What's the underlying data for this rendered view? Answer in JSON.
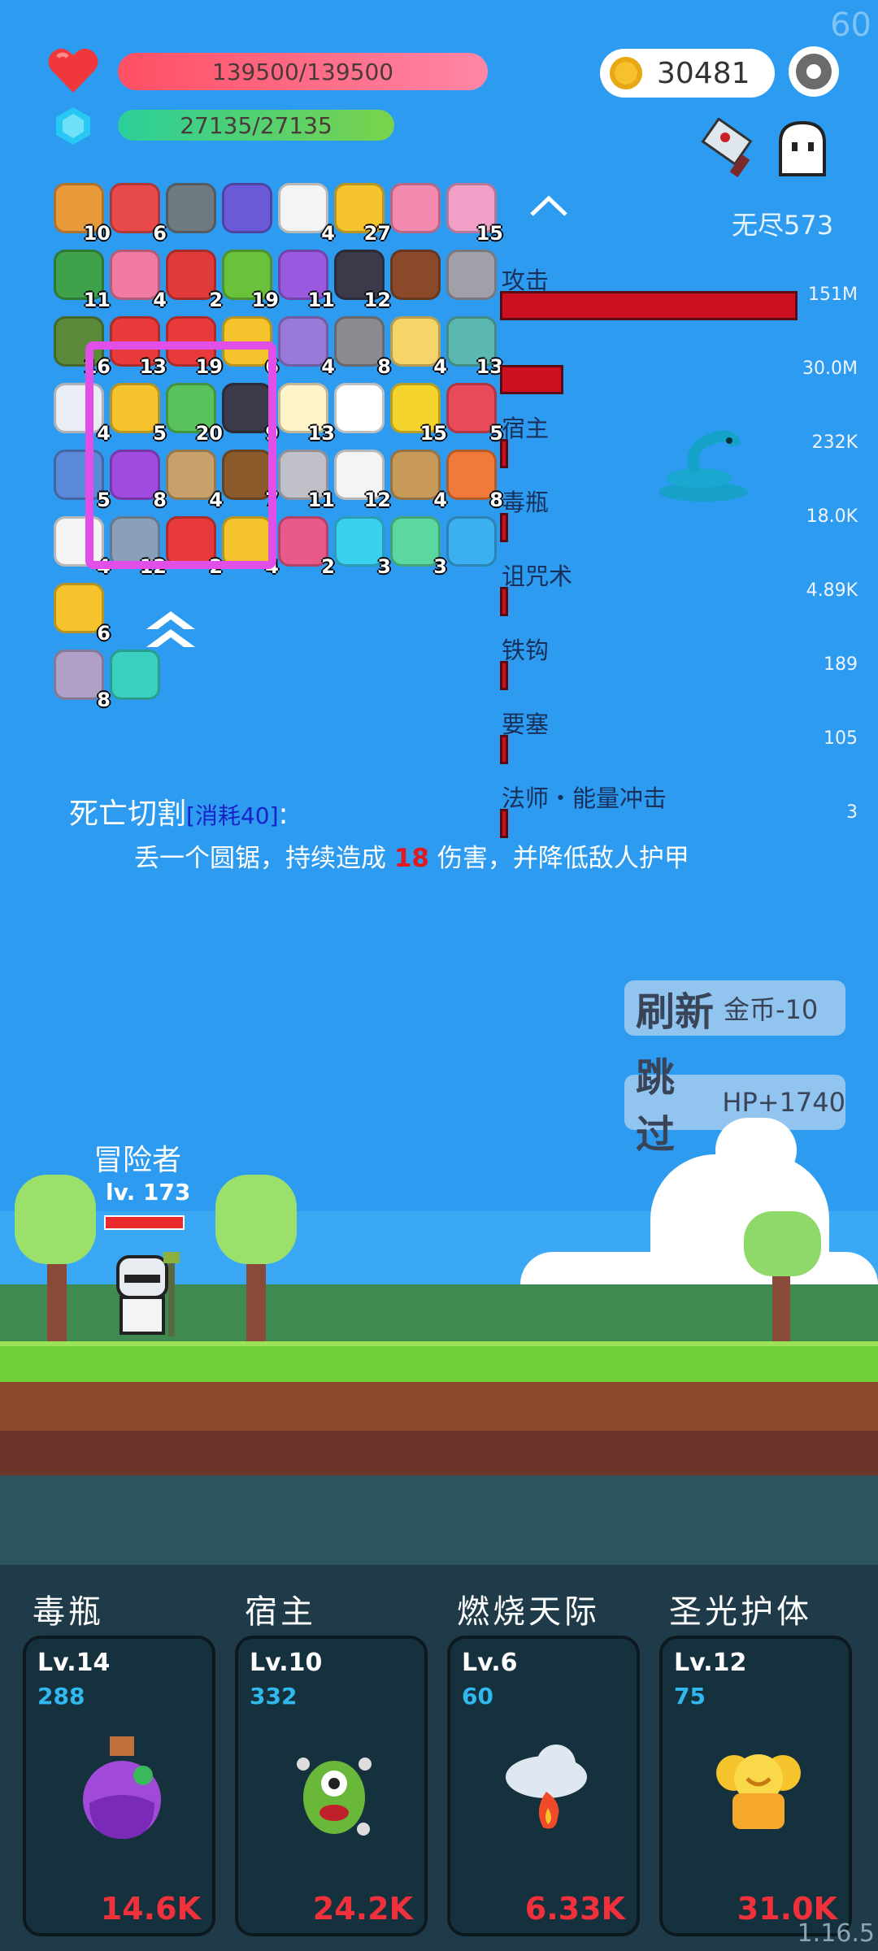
{
  "hud": {
    "fps": "60",
    "hp_text": "139500/139500",
    "mp_text": "27135/27135",
    "coins": "30481",
    "endless_label": "无尽573"
  },
  "items": [
    {
      "name": "book",
      "count": "10",
      "color": "#e89a3a"
    },
    {
      "name": "watermelon",
      "count": "6",
      "color": "#e84a4a"
    },
    {
      "name": "mortar",
      "count": "",
      "color": "#6f7a80"
    },
    {
      "name": "wizard-hat",
      "count": "",
      "color": "#6a5ad8"
    },
    {
      "name": "cloud",
      "count": "4",
      "color": "#f4f4f4"
    },
    {
      "name": "crown",
      "count": "27",
      "color": "#f5c42c"
    },
    {
      "name": "letter",
      "count": "",
      "color": "#f48ab0"
    },
    {
      "name": "ice-cream",
      "count": "15",
      "color": "#f2a0c8"
    },
    {
      "name": "helmet",
      "count": "11",
      "color": "#3fa24a"
    },
    {
      "name": "potion",
      "count": "4",
      "color": "#f07aa0"
    },
    {
      "name": "magnet",
      "count": "2",
      "color": "#e03a3a"
    },
    {
      "name": "goblin",
      "count": "19",
      "color": "#6ac23a"
    },
    {
      "name": "chest",
      "count": "11",
      "color": "#9a5ae0"
    },
    {
      "name": "bat",
      "count": "12",
      "color": "#3a3a4a"
    },
    {
      "name": "mushroom",
      "count": "",
      "color": "#8a4a2a"
    },
    {
      "name": "spike-ball",
      "count": "",
      "color": "#a0a0a8"
    },
    {
      "name": "grenade",
      "count": "16",
      "color": "#5a8a3a"
    },
    {
      "name": "strawberry",
      "count": "13",
      "color": "#e83a3a"
    },
    {
      "name": "red-mushroom",
      "count": "19",
      "color": "#e83a3a"
    },
    {
      "name": "sunflower",
      "count": "6",
      "color": "#f5c42c"
    },
    {
      "name": "star-shield",
      "count": "4",
      "color": "#9a7ad8"
    },
    {
      "name": "tombstone",
      "count": "8",
      "color": "#8a8a90"
    },
    {
      "name": "scroll",
      "count": "4",
      "color": "#f5d46a"
    },
    {
      "name": "target",
      "count": "13",
      "color": "#5ab8b0"
    },
    {
      "name": "lightbulb",
      "count": "4",
      "color": "#e8eef4"
    },
    {
      "name": "ring",
      "count": "5",
      "color": "#f5c42c"
    },
    {
      "name": "money",
      "count": "20",
      "color": "#5ac25a"
    },
    {
      "name": "cauldron",
      "count": "9",
      "color": "#3a3a4a"
    },
    {
      "name": "egg",
      "count": "13",
      "color": "#fff4c8"
    },
    {
      "name": "ghost",
      "count": "",
      "color": "#ffffff"
    },
    {
      "name": "sun-orb",
      "count": "15",
      "color": "#f5d42c"
    },
    {
      "name": "heart",
      "count": "5",
      "color": "#e84a5a"
    },
    {
      "name": "shield",
      "count": "5",
      "color": "#5a8ad8"
    },
    {
      "name": "crystal-ball",
      "count": "8",
      "color": "#a04ae0"
    },
    {
      "name": "noose",
      "count": "4",
      "color": "#c8a06a"
    },
    {
      "name": "coconut",
      "count": "7",
      "color": "#8a5a2a"
    },
    {
      "name": "compass",
      "count": "11",
      "color": "#c0c0c8"
    },
    {
      "name": "dice",
      "count": "12",
      "color": "#f4f4f4"
    },
    {
      "name": "crossbow",
      "count": "4",
      "color": "#c89a5a"
    },
    {
      "name": "meteor",
      "count": "8",
      "color": "#f07a3a"
    },
    {
      "name": "card",
      "count": "4",
      "color": "#f4f4f4"
    },
    {
      "name": "elephant",
      "count": "12",
      "color": "#8aa0b8"
    },
    {
      "name": "hearts",
      "count": "2",
      "color": "#e83a3a"
    },
    {
      "name": "magic-wand",
      "count": "4",
      "color": "#f5c42c"
    },
    {
      "name": "hook",
      "count": "2",
      "color": "#e85a8a"
    },
    {
      "name": "gem",
      "count": "3",
      "color": "#3ad0f0"
    },
    {
      "name": "spirit",
      "count": "3",
      "color": "#5ad8a0"
    },
    {
      "name": "chat",
      "count": "",
      "color": "#3ab0f0"
    },
    {
      "name": "gold-coins",
      "count": "6",
      "color": "#f5c42c"
    },
    {
      "name": "sword-box",
      "count": "8",
      "color": "#b0a0c8"
    },
    {
      "name": "light-box",
      "count": "",
      "color": "#3ad0c0"
    }
  ],
  "damage": [
    {
      "name": "攻击",
      "value": "151M",
      "bar": 1.0
    },
    {
      "name": "",
      "value": "30.0M",
      "bar": 0.2
    },
    {
      "name": "宿主",
      "value": "232K",
      "bar": 0.0
    },
    {
      "name": "毒瓶",
      "value": "18.0K",
      "bar": 0.0
    },
    {
      "name": "诅咒术",
      "value": "4.89K",
      "bar": 0.0
    },
    {
      "name": "铁钩",
      "value": "189",
      "bar": 0.0
    },
    {
      "name": "要塞",
      "value": "105",
      "bar": 0.0
    },
    {
      "name": "法师・能量冲击",
      "value": "3",
      "bar": 0.0
    }
  ],
  "skill": {
    "title": "死亡切割",
    "cost": "[消耗40]",
    "colon": ":",
    "desc_pre": "丢一个圆锯，持续造成 ",
    "desc_num": "18",
    "desc_post": " 伤害，并降低敌人护甲"
  },
  "buttons": {
    "refresh_main": "刷新",
    "refresh_sub": "金币-10",
    "skip_main": "跳过",
    "skip_sub": "HP+1740"
  },
  "hero": {
    "name": "冒险者",
    "level": "lv. 173",
    "hp_fraction": 1.0
  },
  "cards": [
    {
      "title": "毒瓶",
      "lv": "Lv.14",
      "count": "288",
      "dmg": "14.6K",
      "icon": "poison-bottle-icon"
    },
    {
      "title": "宿主",
      "lv": "Lv.10",
      "count": "332",
      "dmg": "24.2K",
      "icon": "host-monster-icon"
    },
    {
      "title": "燃烧天际",
      "lv": "Lv.6",
      "count": "60",
      "dmg": "6.33K",
      "icon": "burning-cloud-icon"
    },
    {
      "title": "圣光护体",
      "lv": "Lv.12",
      "count": "75",
      "dmg": "31.0K",
      "icon": "holy-light-icon"
    }
  ],
  "version": "1.16.5"
}
